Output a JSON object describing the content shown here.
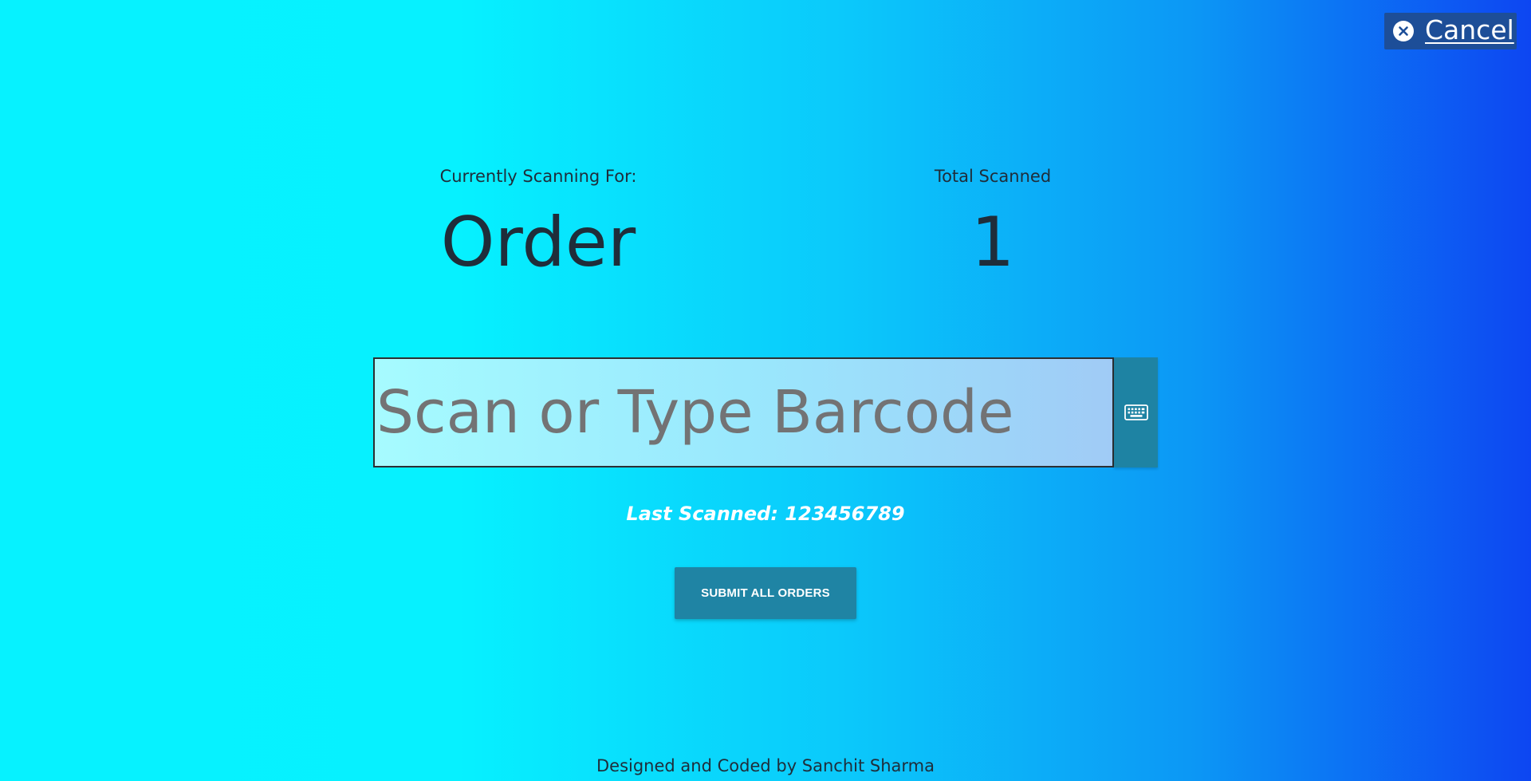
{
  "header": {
    "cancel_label": "Cancel",
    "cancel_icon": "close-circle-icon"
  },
  "stats": {
    "scanning_for_label": "Currently Scanning For:",
    "scanning_for_value": "Order",
    "total_scanned_label": "Total Scanned",
    "total_scanned_value": "1"
  },
  "scanner": {
    "placeholder": "Scan or Type Barcode",
    "value": "",
    "keyboard_icon": "keyboard-icon",
    "last_scanned": "Last Scanned: 123456789"
  },
  "actions": {
    "submit_label": "SUBMIT ALL ORDERS"
  },
  "footer": {
    "credit": "Designed and Coded by Sanchit Sharma"
  },
  "colors": {
    "gradient_start": "#06f2ff",
    "gradient_end": "#0d46f2",
    "button": "#1f84a4",
    "cancel_bg": "#1d4e98",
    "text": "#1f2d3a"
  }
}
